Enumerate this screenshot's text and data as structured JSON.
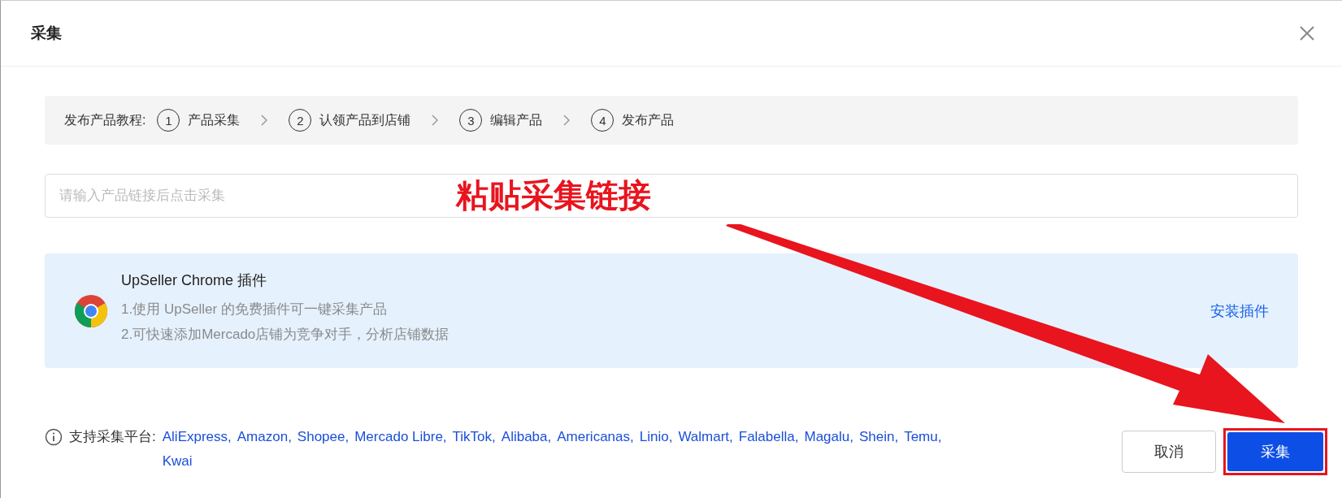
{
  "dialog": {
    "title": "采集"
  },
  "tutorial": {
    "label": "发布产品教程:",
    "steps": [
      {
        "number": "1",
        "label": "产品采集"
      },
      {
        "number": "2",
        "label": "认领产品到店铺"
      },
      {
        "number": "3",
        "label": "编辑产品"
      },
      {
        "number": "4",
        "label": "发布产品"
      }
    ]
  },
  "link_input": {
    "placeholder": "请输入产品链接后点击采集"
  },
  "annotation": {
    "text": "粘贴采集链接"
  },
  "plugin": {
    "title": "UpSeller Chrome 插件",
    "lines": [
      "1.使用 UpSeller 的免费插件可一键采集产品",
      "2.可快速添加Mercado店铺为竞争对手，分析店铺数据"
    ],
    "action": "安装插件"
  },
  "platforms": {
    "label": "支持采集平台:",
    "items": [
      "AliExpress,",
      "Amazon,",
      "Shopee,",
      "Mercado Libre,",
      "TikTok,",
      "Alibaba,",
      "Americanas,",
      "Linio,",
      "Walmart,",
      "Falabella,",
      "Magalu,",
      "Shein,",
      "Temu,",
      "Kwai"
    ]
  },
  "buttons": {
    "cancel": "取消",
    "submit": "采集"
  }
}
